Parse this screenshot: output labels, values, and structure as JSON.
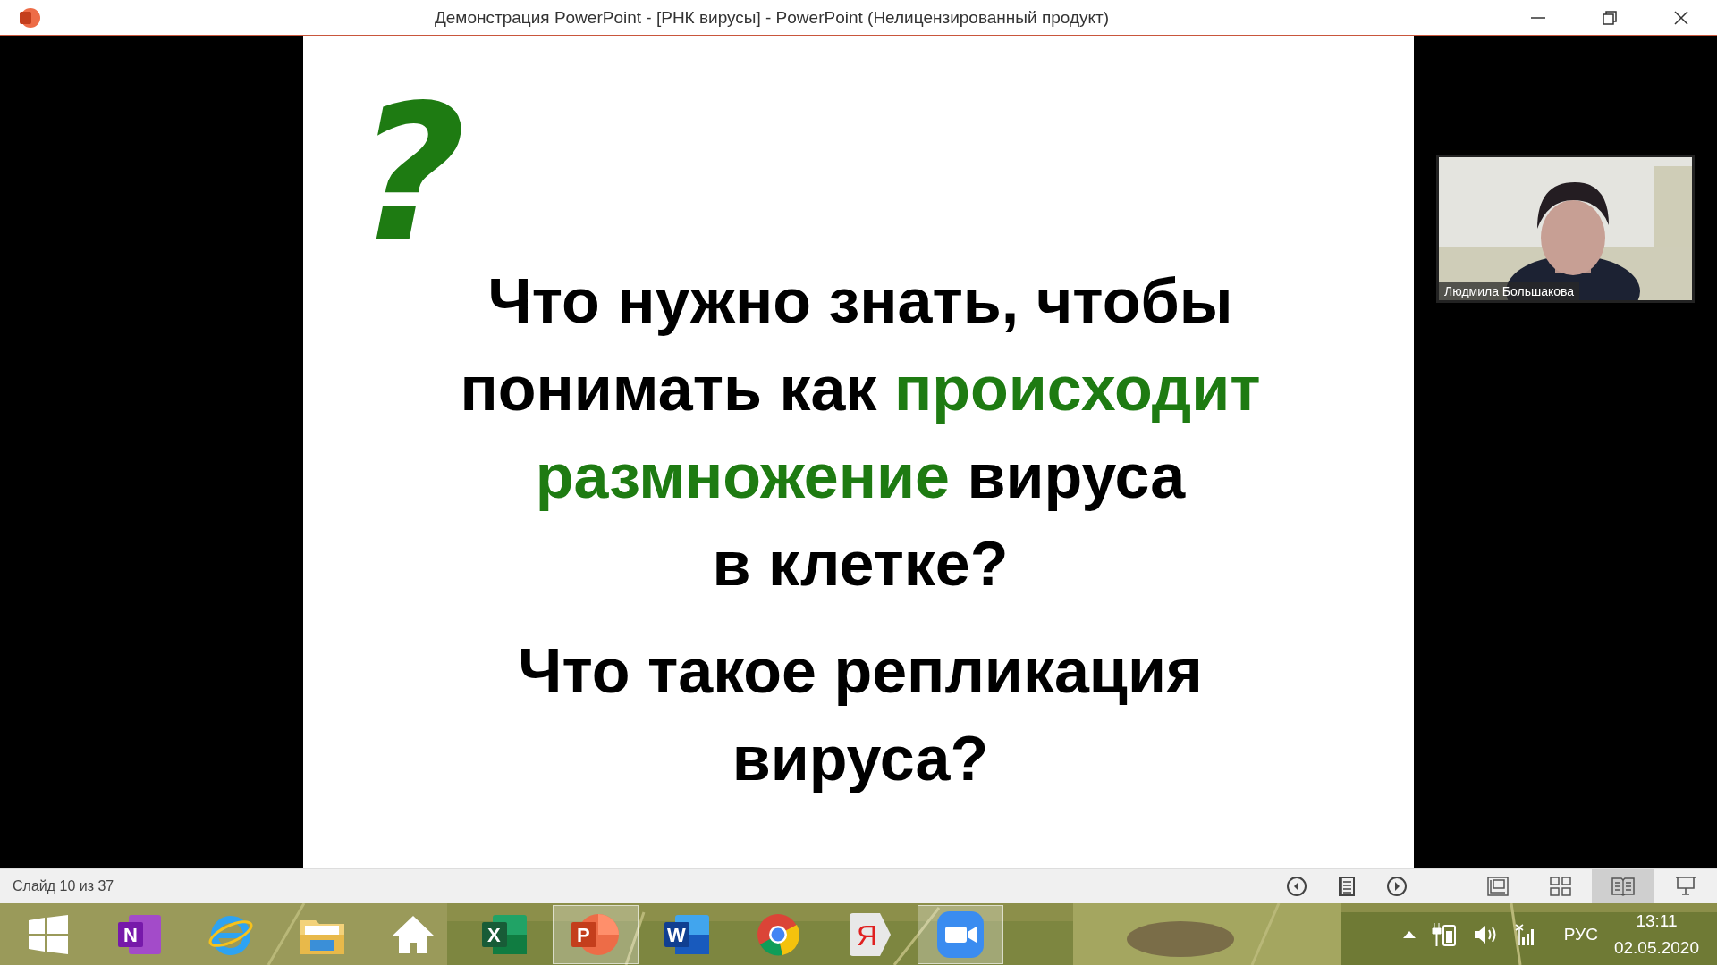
{
  "window": {
    "title": "Демонстрация PowerPoint - [РНК вирусы] - PowerPoint (Нелицензированный продукт)"
  },
  "slide": {
    "mark": "?",
    "questions": [
      {
        "lines": [
          [
            {
              "text": "Что нужно знать, чтобы",
              "highlight": false
            }
          ],
          [
            {
              "text": "понимать как ",
              "highlight": false
            },
            {
              "text": "происходит",
              "highlight": true
            }
          ],
          [
            {
              "text": "размножение",
              "highlight": true
            },
            {
              "text": " вируса",
              "highlight": false
            }
          ],
          [
            {
              "text": "в клетке?",
              "highlight": false
            }
          ]
        ]
      },
      {
        "lines": [
          [
            {
              "text": "Что такое репликация",
              "highlight": false
            }
          ],
          [
            {
              "text": "вируса?",
              "highlight": false
            }
          ]
        ]
      }
    ]
  },
  "video": {
    "kind": "picture",
    "name": "Людмила Большакова"
  },
  "status_bar": {
    "slide_counter": "Слайд 10 из 37",
    "nav": [
      {
        "kind": "prev"
      },
      {
        "kind": "notes"
      },
      {
        "kind": "next"
      }
    ],
    "views": [
      {
        "kind": "normal",
        "selected": false
      },
      {
        "kind": "sorter",
        "selected": false
      },
      {
        "kind": "reading",
        "selected": true
      },
      {
        "kind": "slideshow",
        "selected": false
      }
    ]
  },
  "taskbar": {
    "apps": [
      {
        "kind": "start",
        "active": false
      },
      {
        "kind": "onenote",
        "letter": "N",
        "active": false
      },
      {
        "kind": "ie",
        "active": false
      },
      {
        "kind": "explorer",
        "active": false
      },
      {
        "kind": "home",
        "active": false
      },
      {
        "kind": "excel",
        "letter": "X",
        "active": false
      },
      {
        "kind": "powerpoint",
        "letter": "P",
        "active": true
      },
      {
        "kind": "word",
        "letter": "W",
        "active": false
      },
      {
        "kind": "chrome",
        "active": false
      },
      {
        "kind": "yandex",
        "letter": "Я",
        "active": false
      },
      {
        "kind": "zoom",
        "active": true
      }
    ],
    "language": "РУС",
    "time": "13:11",
    "date": "02.05.2020"
  }
}
